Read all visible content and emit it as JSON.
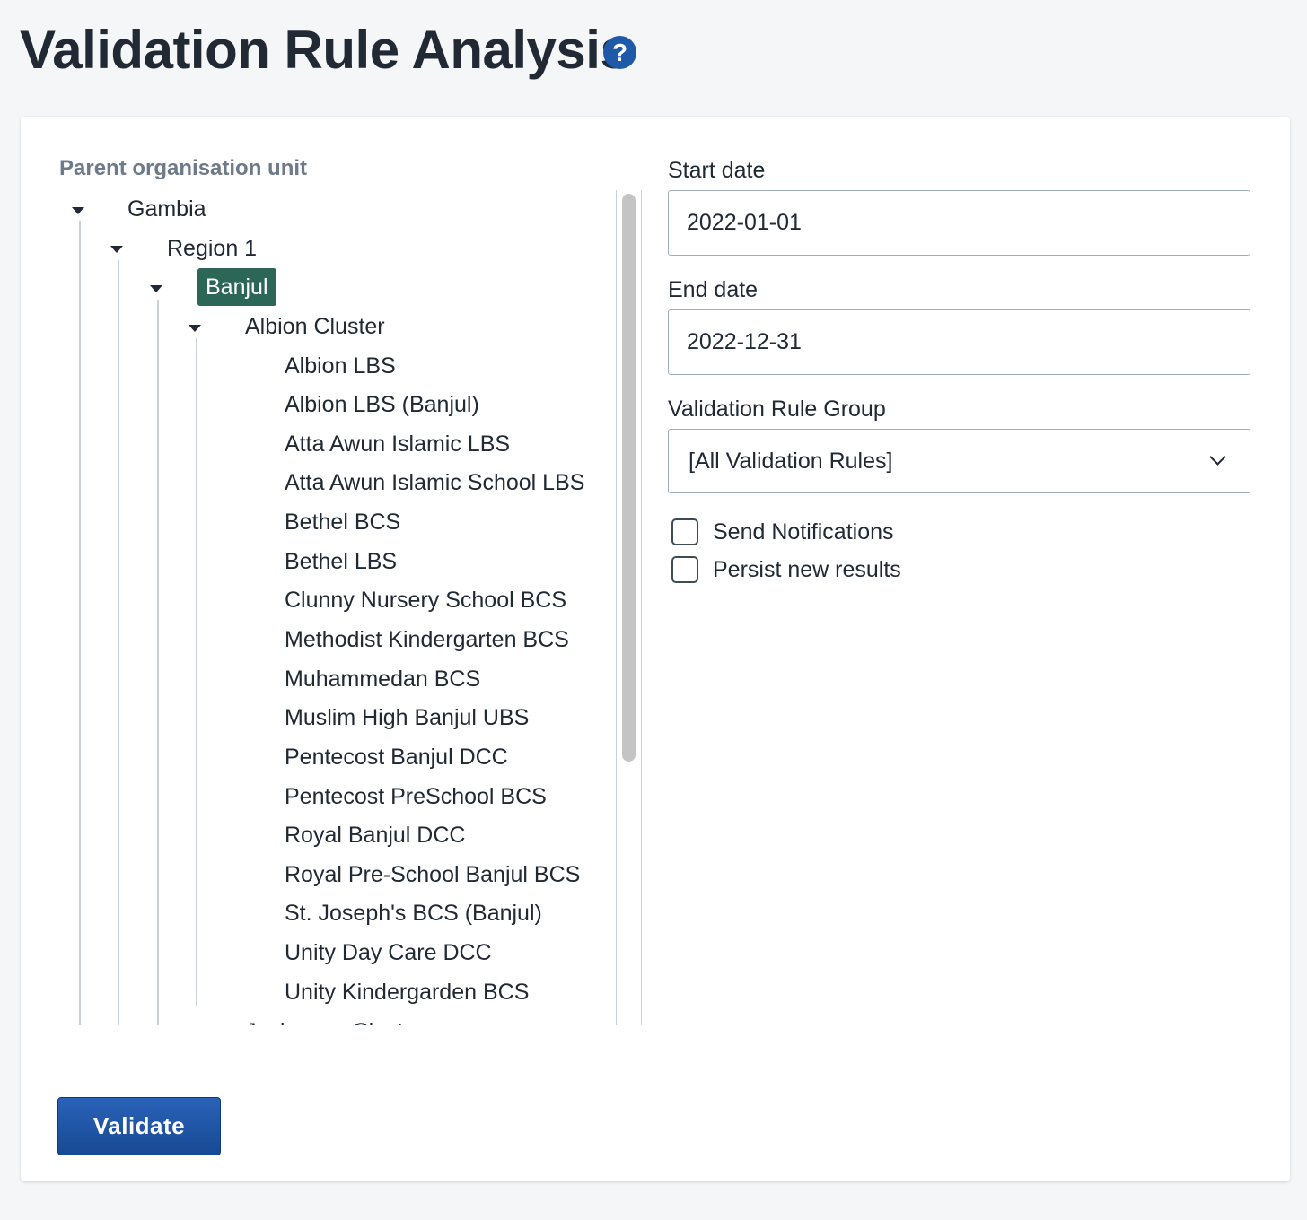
{
  "header": {
    "title": "Validation Rule Analysis",
    "help_icon": "?"
  },
  "org_tree": {
    "label": "Parent organisation unit",
    "level0": "Gambia",
    "level1": "Region 1",
    "level2_selected": "Banjul",
    "level3": "Albion Cluster",
    "leaves": [
      "Albion LBS",
      "Albion LBS (Banjul)",
      "Atta Awun Islamic LBS",
      "Atta Awun Islamic School LBS",
      "Bethel BCS",
      "Bethel LBS",
      "Clunny Nursery School BCS",
      "Methodist Kindergarten BCS",
      "Muhammedan BCS",
      "Muslim High Banjul UBS",
      "Pentecost Banjul DCC",
      "Pentecost PreSchool BCS",
      "Royal Banjul DCC",
      "Royal Pre-School Banjul BCS",
      "St. Joseph's BCS (Banjul)",
      "Unity Day Care DCC",
      "Unity Kindergarden BCS"
    ],
    "next_cluster_partial": "Jeshwang Cluster"
  },
  "form": {
    "start_date_label": "Start date",
    "start_date_value": "2022-01-01",
    "end_date_label": "End date",
    "end_date_value": "2022-12-31",
    "rule_group_label": "Validation Rule Group",
    "rule_group_value": "[All Validation Rules]",
    "send_notifications_label": "Send Notifications",
    "send_notifications_checked": false,
    "persist_results_label": "Persist new results",
    "persist_results_checked": false
  },
  "actions": {
    "validate_label": "Validate"
  },
  "colors": {
    "selected_node": "#2b6656",
    "primary_button": "#1e5aa8",
    "help_icon": "#1e5aa8"
  }
}
